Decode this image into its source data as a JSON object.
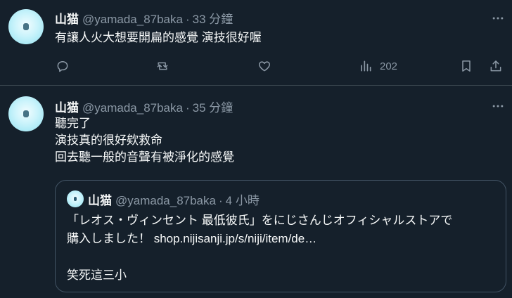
{
  "tweets": [
    {
      "name": "山猫",
      "handle": "@yamada_87baka",
      "separator": "·",
      "time": "33 分鐘",
      "lines": [
        "有讓人火大想要開扁的感覺 演技很好喔"
      ],
      "actions": {
        "views": "202"
      }
    },
    {
      "name": "山猫",
      "handle": "@yamada_87baka",
      "separator": "·",
      "time": "35 分鐘",
      "lines": [
        "聽完了",
        "演技真的很好欸救命",
        "回去聽一般的音聲有被淨化的感覺"
      ],
      "quote": {
        "name": "山猫",
        "handle": "@yamada_87baka",
        "separator": "·",
        "time": "4 小時",
        "lines": [
          "「レオス・ヴィンセント 最低彼氏」をにじさんじオフィシャルストアで",
          "購入しました！ shop.nijisanji.jp/s/niji/item/de…",
          "笑死這三小"
        ]
      }
    }
  ],
  "icons": {
    "more": "more-horizontal-icon",
    "reply": "reply-icon",
    "retweet": "retweet-icon",
    "like": "heart-icon",
    "views": "views-bar-chart-icon",
    "bookmark": "bookmark-icon",
    "share": "share-icon"
  },
  "colors": {
    "background": "#15202b",
    "text": "#f7f9f9",
    "secondary": "#8b98a5",
    "divider": "#38444d"
  }
}
